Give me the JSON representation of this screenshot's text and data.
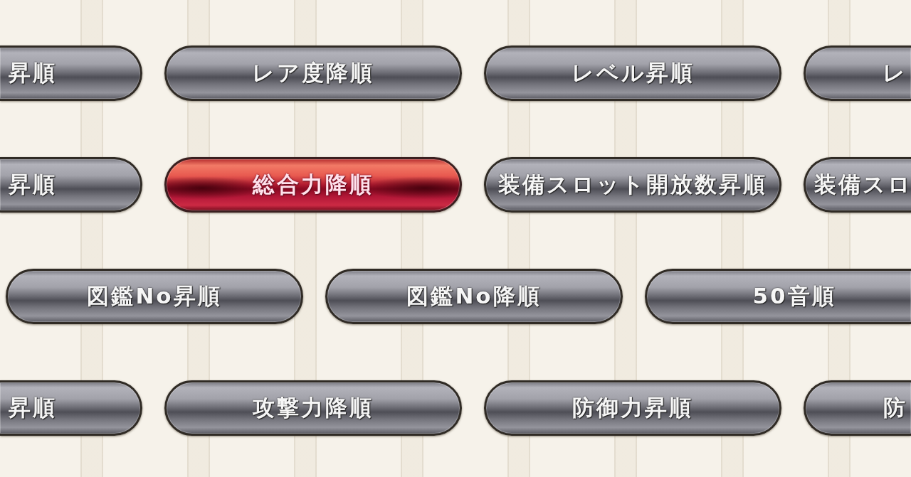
{
  "rows": [
    {
      "buttons": [
        {
          "label": "昇順",
          "kind": "cut-left",
          "selected": false
        },
        {
          "label": "レア度降順",
          "kind": "full",
          "selected": false
        },
        {
          "label": "レベル昇順",
          "kind": "full",
          "selected": false
        },
        {
          "label": "レ",
          "kind": "cut-right",
          "selected": false
        }
      ]
    },
    {
      "buttons": [
        {
          "label": "昇順",
          "kind": "cut-left",
          "selected": false
        },
        {
          "label": "総合力降順",
          "kind": "full",
          "selected": true
        },
        {
          "label": "装備スロット開放数昇順",
          "kind": "full",
          "selected": false
        },
        {
          "label": "装備スロ",
          "kind": "cut-right",
          "selected": false
        }
      ]
    },
    {
      "buttons": [
        {
          "label": "図鑑No昇順",
          "kind": "full",
          "selected": false
        },
        {
          "label": "図鑑No降順",
          "kind": "full",
          "selected": false
        },
        {
          "label": "50音順",
          "kind": "open-right",
          "selected": false
        }
      ]
    },
    {
      "buttons": [
        {
          "label": "昇順",
          "kind": "cut-left",
          "selected": false
        },
        {
          "label": "攻撃力降順",
          "kind": "full",
          "selected": false
        },
        {
          "label": "防御力昇順",
          "kind": "full",
          "selected": false
        },
        {
          "label": "防",
          "kind": "cut-right",
          "selected": false
        }
      ]
    }
  ]
}
